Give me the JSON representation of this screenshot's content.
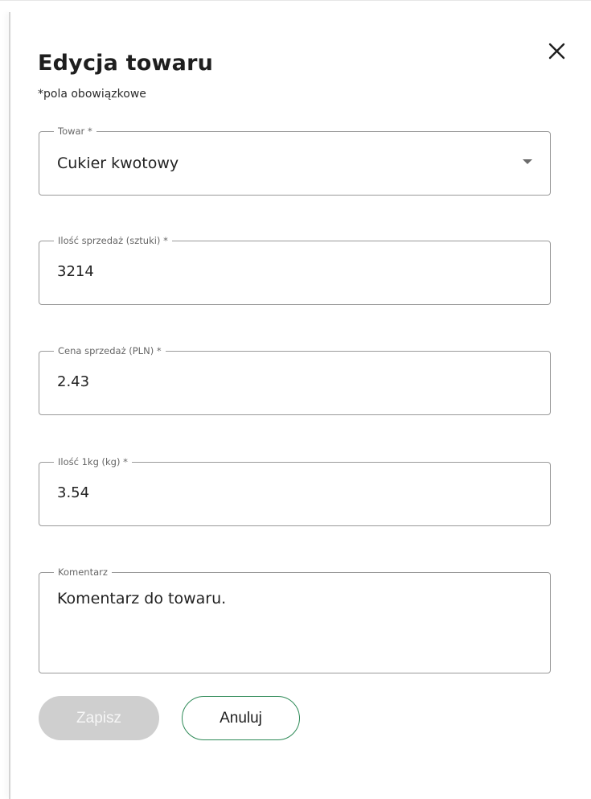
{
  "dialog": {
    "title": "Edycja towaru",
    "subtitle": "*pola obowiązkowe",
    "close_icon": "close-icon"
  },
  "fields": {
    "towar": {
      "label": "Towar *",
      "value": "Cukier kwotowy",
      "icon": "chevron-down-icon"
    },
    "ilosc_sprzedaz": {
      "label": "Ilość sprzedaż (sztuki) *",
      "value": "3214"
    },
    "cena_sprzedaz": {
      "label": "Cena sprzedaż (PLN) *",
      "value": "2.43"
    },
    "ilosc_kg": {
      "label": "Ilość 1kg (kg) *",
      "value": "3.54"
    },
    "komentarz": {
      "label": "Komentarz",
      "value": "Komentarz do towaru."
    }
  },
  "buttons": {
    "save": "Zapisz",
    "cancel": "Anuluj"
  },
  "colors": {
    "accent": "#2e8a57",
    "disabled_button": "#cfcfcf",
    "border": "#9a9a9a"
  }
}
